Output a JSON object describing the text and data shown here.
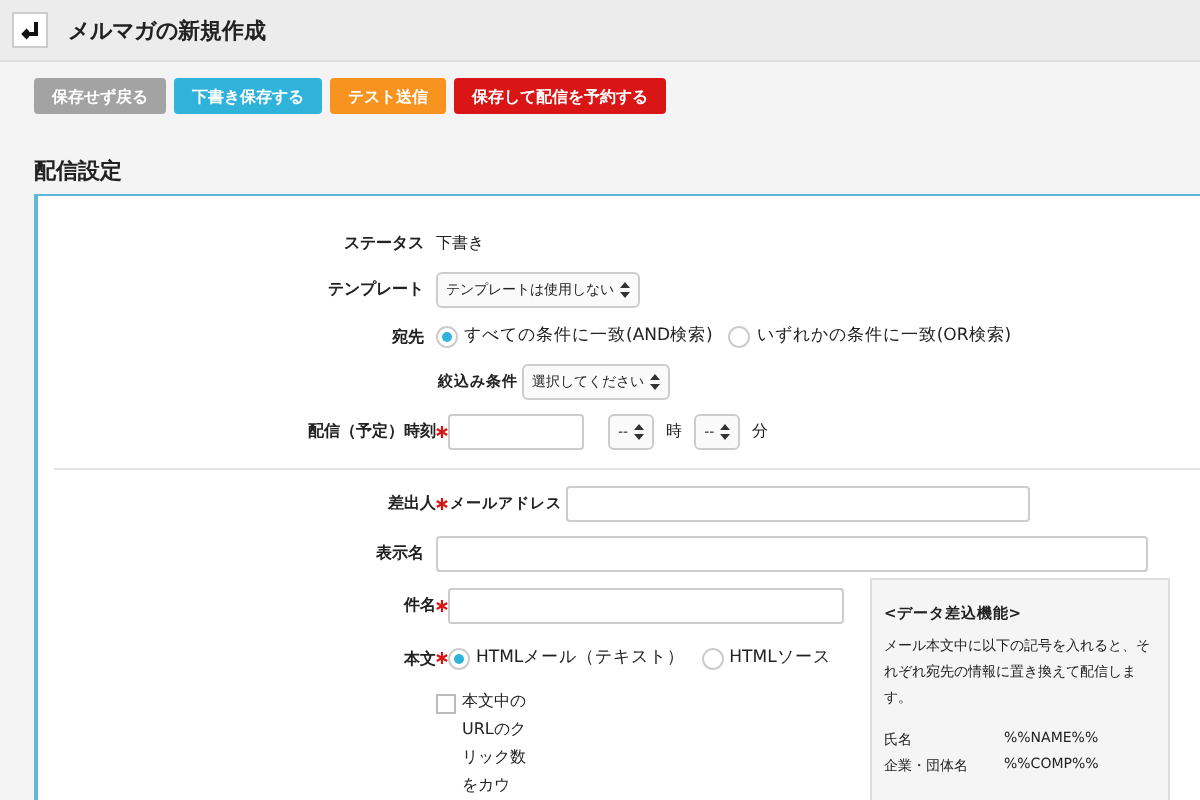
{
  "header": {
    "title": "メルマガの新規作成"
  },
  "actions": [
    {
      "label": "保存せず戻る",
      "kind": "neutral"
    },
    {
      "label": "下書き保存する",
      "kind": "info"
    },
    {
      "label": "テスト送信",
      "kind": "warning"
    },
    {
      "label": "保存して配信を予約する",
      "kind": "danger"
    }
  ],
  "section": {
    "title": "配信設定"
  },
  "status": {
    "label": "ステータス",
    "value": "下書き"
  },
  "template": {
    "label": "テンプレート",
    "value": "テンプレートは使用しない"
  },
  "recipients": {
    "label": "宛先",
    "options": [
      {
        "label": "すべての条件に一致(AND検索)",
        "selected": true
      },
      {
        "label": "いずれかの条件に一致(OR検索)",
        "selected": false
      }
    ],
    "filter": {
      "label": "絞込み条件",
      "value": "選択してください"
    }
  },
  "schedule": {
    "label": "配信（予定）時刻",
    "required": true,
    "hour": "--",
    "hour_unit": "時",
    "minute": "--",
    "minute_unit": "分"
  },
  "sender": {
    "label": "差出人",
    "required": true,
    "sublabel": "メールアドレス"
  },
  "display_name": {
    "label": "表示名"
  },
  "subject": {
    "label": "件名",
    "required": true
  },
  "body": {
    "label": "本文",
    "required": true,
    "options": [
      {
        "label": "HTMLメール（テキスト）",
        "selected": true
      },
      {
        "label": "HTMLソース",
        "selected": false
      }
    ],
    "track_clicks": {
      "label": "本文中のURLのクリック数をカウ",
      "checked": false
    }
  },
  "merge_panel": {
    "title": "<データ差込機能>",
    "description": "メール本文中に以下の記号を入れると、それぞれ宛先の情報に置き換えて配信します。",
    "fields": [
      {
        "name": "氏名",
        "code": "%%NAME%%"
      },
      {
        "name": "企業・団体名",
        "code": "%%COMP%%"
      }
    ]
  }
}
